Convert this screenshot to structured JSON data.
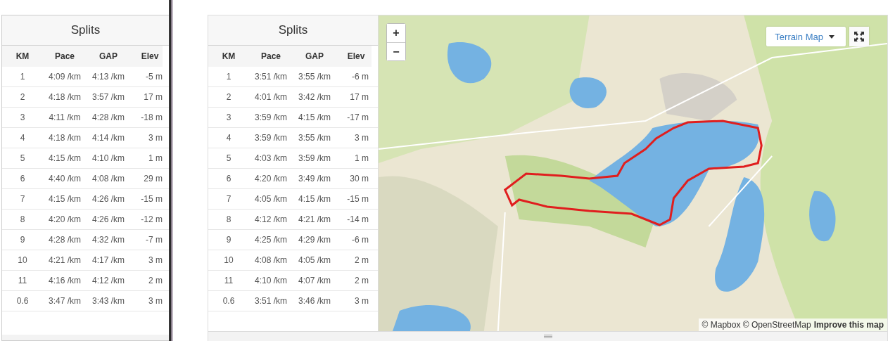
{
  "panels": [
    {
      "title": "Splits",
      "columns": [
        "KM",
        "Pace",
        "GAP",
        "Elev"
      ],
      "rows": [
        [
          "1",
          "4:09 /km",
          "4:13 /km",
          "-5 m"
        ],
        [
          "2",
          "4:18 /km",
          "3:57 /km",
          "17 m"
        ],
        [
          "3",
          "4:11 /km",
          "4:28 /km",
          "-18 m"
        ],
        [
          "4",
          "4:18 /km",
          "4:14 /km",
          "3 m"
        ],
        [
          "5",
          "4:15 /km",
          "4:10 /km",
          "1 m"
        ],
        [
          "6",
          "4:40 /km",
          "4:08 /km",
          "29 m"
        ],
        [
          "7",
          "4:15 /km",
          "4:26 /km",
          "-15 m"
        ],
        [
          "8",
          "4:20 /km",
          "4:26 /km",
          "-12 m"
        ],
        [
          "9",
          "4:28 /km",
          "4:32 /km",
          "-7 m"
        ],
        [
          "10",
          "4:21 /km",
          "4:17 /km",
          "3 m"
        ],
        [
          "11",
          "4:16 /km",
          "4:12 /km",
          "2 m"
        ],
        [
          "0.6",
          "3:47 /km",
          "3:43 /km",
          "3 m"
        ]
      ]
    },
    {
      "title": "Splits",
      "columns": [
        "KM",
        "Pace",
        "GAP",
        "Elev"
      ],
      "rows": [
        [
          "1",
          "3:51 /km",
          "3:55 /km",
          "-6 m"
        ],
        [
          "2",
          "4:01 /km",
          "3:42 /km",
          "17 m"
        ],
        [
          "3",
          "3:59 /km",
          "4:15 /km",
          "-17 m"
        ],
        [
          "4",
          "3:59 /km",
          "3:55 /km",
          "3 m"
        ],
        [
          "5",
          "4:03 /km",
          "3:59 /km",
          "1 m"
        ],
        [
          "6",
          "4:20 /km",
          "3:49 /km",
          "30 m"
        ],
        [
          "7",
          "4:05 /km",
          "4:15 /km",
          "-15 m"
        ],
        [
          "8",
          "4:12 /km",
          "4:21 /km",
          "-14 m"
        ],
        [
          "9",
          "4:25 /km",
          "4:29 /km",
          "-6 m"
        ],
        [
          "10",
          "4:08 /km",
          "4:05 /km",
          "2 m"
        ],
        [
          "11",
          "4:10 /km",
          "4:07 /km",
          "2 m"
        ],
        [
          "0.6",
          "3:51 /km",
          "3:46 /km",
          "3 m"
        ]
      ]
    }
  ],
  "map": {
    "zoom_in": "+",
    "zoom_out": "−",
    "layer_menu": "Terrain Map",
    "attribution": "© Mapbox © OpenStreetMap",
    "improve_link": "Improve this map"
  }
}
